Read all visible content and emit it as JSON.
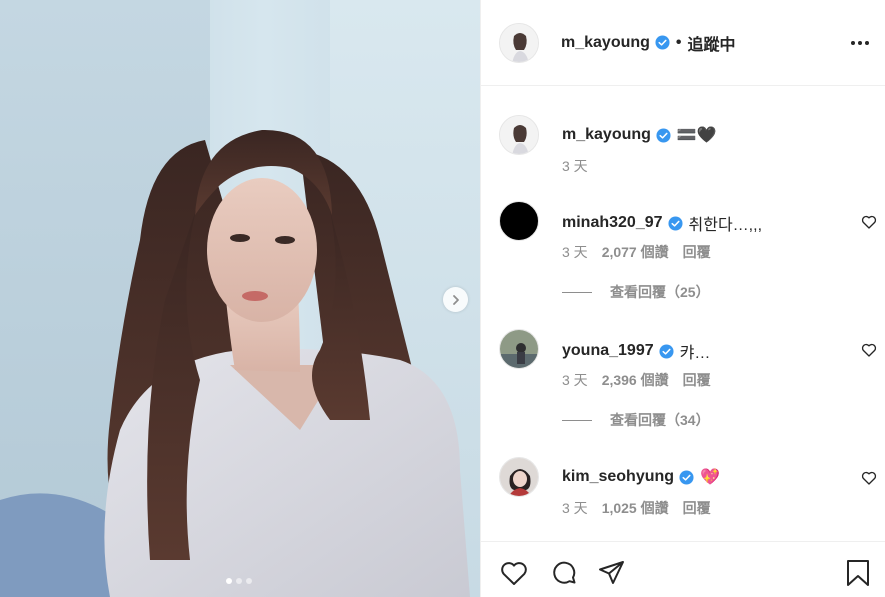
{
  "header": {
    "username": "m_kayoung",
    "separator": "•",
    "follow_status": "追蹤中"
  },
  "caption": {
    "username": "m_kayoung",
    "text": "🟰🖤",
    "time": "3 天"
  },
  "comments": [
    {
      "username": "minah320_97",
      "text": "취한다…,,,",
      "time": "3 天",
      "likes": "2,077 個讚",
      "reply_label": "回覆",
      "view_replies": "查看回覆（25）"
    },
    {
      "username": "youna_1997",
      "text": "캬…",
      "time": "3 天",
      "likes": "2,396 個讚",
      "reply_label": "回覆",
      "view_replies": "查看回覆（34）"
    },
    {
      "username": "kim_seohyung",
      "text": "💖",
      "time": "3 天",
      "likes": "1,025 個讚",
      "reply_label": "回覆"
    }
  ],
  "carousel": {
    "current": 1,
    "total": 3
  },
  "icons": {
    "verified": "verified-badge-icon",
    "like": "heart-icon",
    "comment": "comment-icon",
    "share": "send-icon",
    "save": "bookmark-icon",
    "more": "more-options-icon",
    "next": "chevron-right-icon"
  },
  "colors": {
    "verified_blue": "#3897f0",
    "text": "#262626",
    "muted": "#8e8e8e",
    "border": "#efefef"
  }
}
